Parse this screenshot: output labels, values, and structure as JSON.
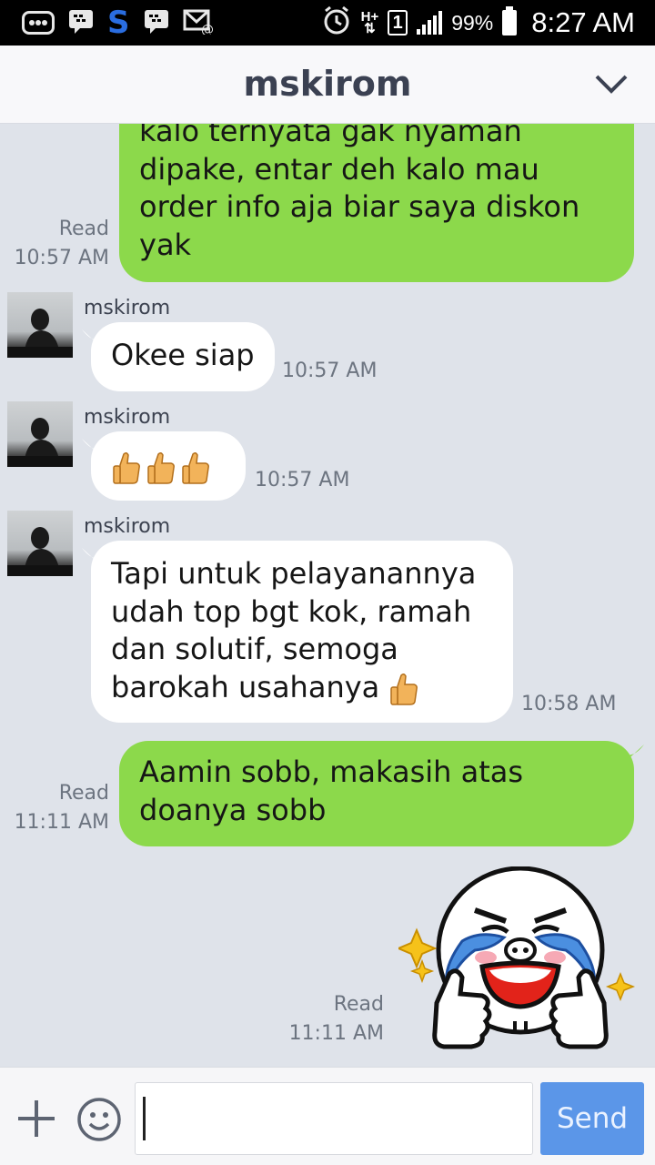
{
  "status_bar": {
    "battery_pct": "99%",
    "time": "8:27 AM",
    "network": "H+",
    "sim": "1"
  },
  "header": {
    "title": "mskirom"
  },
  "messages": [
    {
      "type": "sent",
      "lines": [
        "kalo ternyata gak nyaman",
        "dipake, entar deh kalo mau",
        "order info aja biar saya diskon",
        "yak"
      ],
      "read_label": "Read",
      "time": "10:57 AM"
    },
    {
      "type": "received",
      "sender": "mskirom",
      "text": "Okee siap",
      "time": "10:57 AM"
    },
    {
      "type": "received",
      "sender": "mskirom",
      "emoji": "thumbs-up x3",
      "time": "10:57 AM"
    },
    {
      "type": "received",
      "sender": "mskirom",
      "lines": [
        "Tapi untuk pelayanannya",
        "udah top bgt kok, ramah",
        "dan solutif, semoga",
        "barokah usahanya"
      ],
      "time": "10:58 AM"
    },
    {
      "type": "sent",
      "lines": [
        "Aamin sobb, makasih atas",
        "doanya sobb"
      ],
      "read_label": "Read",
      "time": "11:11 AM"
    },
    {
      "type": "sent-sticker",
      "sticker": "crying-face-thumbs-up-sticker",
      "read_label": "Read",
      "time": "11:11 AM"
    }
  ],
  "input_bar": {
    "placeholder": "",
    "value": "",
    "send_label": "Send"
  },
  "colors": {
    "sent_bubble": "#8cd94b",
    "received_bubble": "#ffffff",
    "chat_background": "#dfe3ea",
    "send_button": "#5b96e8",
    "header_title": "#3b4152"
  }
}
